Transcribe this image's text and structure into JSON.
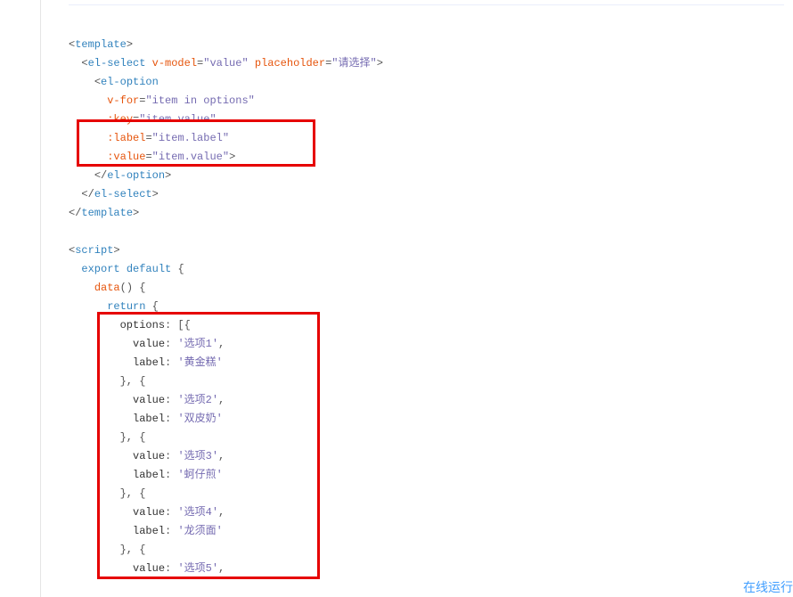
{
  "tags": {
    "template": "template",
    "elSelect": "el-select",
    "elOption": "el-option",
    "script": "script"
  },
  "attrs": {
    "vModel": "v-model",
    "placeholder": "placeholder",
    "vFor": "v-for",
    "key": ":key",
    "label": ":label",
    "value": ":value"
  },
  "vals": {
    "model": "\"value\"",
    "placeholder": "\"请选择\"",
    "vFor": "\"item in options\"",
    "key": "\"item.value\"",
    "label": "\"item.label\"",
    "value": "\"item.value\""
  },
  "kw": {
    "export": "export",
    "default": "default",
    "data": "data",
    "return": "return"
  },
  "keys": {
    "options": "options",
    "value": "value",
    "label": "label"
  },
  "str": {
    "opt1": "'选项1'",
    "lbl1": "'黄金糕'",
    "opt2": "'选项2'",
    "lbl2": "'双皮奶'",
    "opt3": "'选项3'",
    "lbl3": "'蚵仔煎'",
    "opt4": "'选项4'",
    "lbl4": "'龙须面'",
    "opt5": "'选项5'"
  },
  "bottomLink": "在线运行"
}
